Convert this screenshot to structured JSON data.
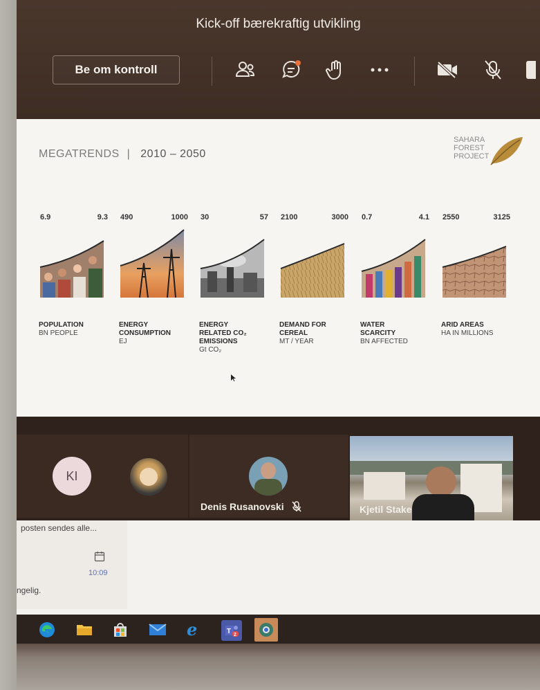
{
  "meeting": {
    "title": "Kick-off bærekraftig utvikling",
    "control_button": "Be om kontroll",
    "tools": [
      "people-icon",
      "chat-icon",
      "raise-hand-icon",
      "more-icon",
      "camera-off-icon",
      "mic-off-icon"
    ]
  },
  "slide": {
    "heading": "MEGATRENDS",
    "separator": "|",
    "years": "2010 – 2050",
    "logo_text": "SAHARA\nFOREST\nPROJECT",
    "trends": [
      {
        "start": "6.9",
        "end": "9.3",
        "label": "POPULATION",
        "unit": "BN PEOPLE"
      },
      {
        "start": "490",
        "end": "1000",
        "label": "ENERGY\nCONSUMPTION",
        "unit": "EJ"
      },
      {
        "start": "30",
        "end": "57",
        "label": "ENERGY\nRELATED CO₂\nEMISSIONS",
        "unit": "Gt CO₂"
      },
      {
        "start": "2100",
        "end": "3000",
        "label": "DEMAND FOR\nCEREAL",
        "unit": "MT / YEAR"
      },
      {
        "start": "0.7",
        "end": "4.1",
        "label": "WATER\nSCARCITY",
        "unit": "BN AFFECTED"
      },
      {
        "start": "2550",
        "end": "3125",
        "label": "ARID AREAS",
        "unit": "HA IN MILLIONS"
      }
    ]
  },
  "participants": {
    "initials": "KI",
    "denis": "Denis Rusanovski",
    "kjetil": "Kjetil Stake"
  },
  "chat": {
    "top_text": "posten sendes alle...",
    "time": "10:09",
    "bottom_text": "ngelig."
  },
  "colors": {
    "header_bg": "#4a372c",
    "slide_bg": "#f7f5f1",
    "accent_orange": "#e8703a"
  }
}
